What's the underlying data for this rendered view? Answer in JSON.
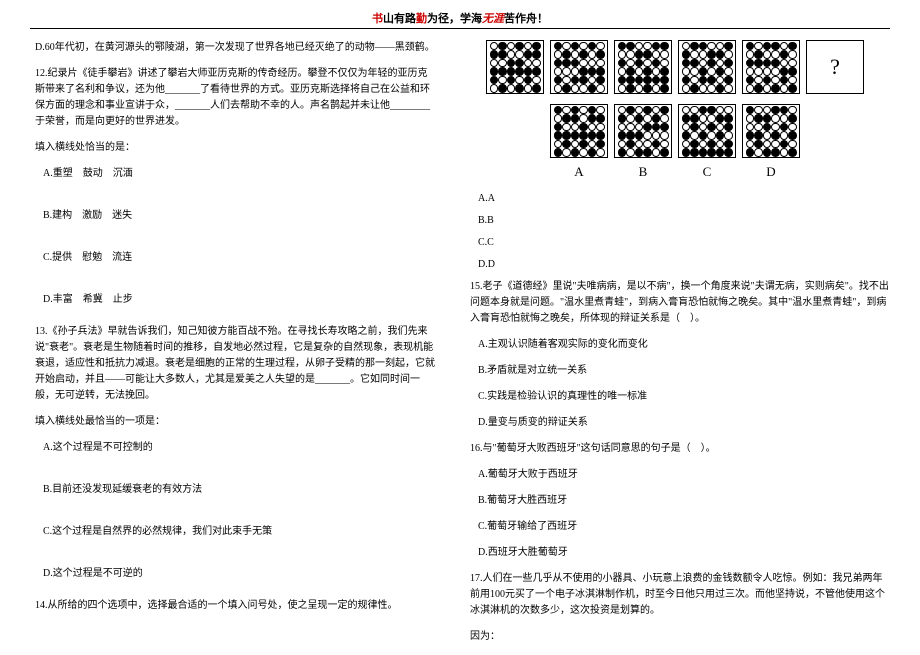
{
  "header": {
    "p1a": "书",
    "p1b": "山有路",
    "p1c": "勤",
    "p1d": "为径，学海",
    "p1e": "无涯",
    "p1f": "苦作舟！"
  },
  "left": {
    "q11d": "D.60年代初，在黄河源头的鄂陵湖，第一次发现了世界各地已经灭绝了的动物——黑颈鹤。",
    "q12": "12.纪录片《徒手攀岩》讲述了攀岩大师亚历克斯的传奇经历。攀登不仅仅为年轻的亚历克斯带来了名利和争议，还为他_______了看待世界的方式。亚历克斯选择将自己在公益和环保方面的理念和事业宣讲于众，_______人们去帮助不幸的人。声名鹊起并未让他________于荣誉，而是向更好的世界进发。",
    "q12prompt": "填入横线处恰当的是：",
    "q12a": "A.重塑　鼓动　沉湎",
    "q12b": "B.建构　激励　迷失",
    "q12c": "C.提供　慰勉　流连",
    "q12d": "D.丰富　希冀　止步",
    "q13": "13.《孙子兵法》早就告诉我们，知己知彼方能百战不殆。在寻找长寿攻略之前，我们先来说\"衰老\"。衰老是生物随着时间的推移，自发地必然过程，它是复杂的自然现象，表现机能衰退，适应性和抵抗力减退。衰老是细胞的正常的生理过程，从卵子受精的那一刻起，它就开始启动，并且——可能让大多数人，尤其是爱美之人失望的是_______。它如同时间一般，无可逆转，无法挽回。",
    "q13prompt": "填入横线处最恰当的一项是：",
    "q13a": "A.这个过程是不可控制的",
    "q13b": "B.目前还没发现延缓衰老的有效方法",
    "q13c": "C.这个过程是自然界的必然规律，我们对此束手无策",
    "q13d": "D.这个过程是不可逆的",
    "q14": "14.从所给的四个选项中，选择最合适的一个填入问号处，使之呈现一定的规律性。"
  },
  "right": {
    "puzzleLabels": {
      "a": "A",
      "b": "B",
      "c": "C",
      "d": "D"
    },
    "questionMark": "?",
    "q14a": "A.A",
    "q14b": "B.B",
    "q14c": "C.C",
    "q14d": "D.D",
    "q15": "15.老子《道德经》里说\"夫唯病病，是以不病\"，换一个角度来说\"夫谓无病，实则病矣\"。找不出问题本身就是问题。\"温水里煮青蛙\"，到病入膏肓恐怕就悔之晚矣。其中\"温水里煮青蛙\"，到病入膏肓恐怕就悔之晚矣，所体现的辩证关系是（　）。",
    "q15a": "A.主观认识随着客观实际的变化而变化",
    "q15b": "B.矛盾就是对立统一关系",
    "q15c": "C.实践是检验认识的真理性的唯一标准",
    "q15d": "D.量变与质变的辩证关系",
    "q16": "16.与\"葡萄牙大败西班牙\"这句话同意思的句子是（　）。",
    "q16a": "A.葡萄牙大败于西班牙",
    "q16b": "B.葡萄牙大胜西班牙",
    "q16c": "C.葡萄牙输给了西班牙",
    "q16d": "D.西班牙大胜葡萄牙",
    "q17": "17.人们在一些几乎从不使用的小器具、小玩意上浪费的金钱数额令人吃惊。例如：我兄弟两年前用100元买了一个电子冰淇淋制作机，时至今日他只用过三次。而他坚持说，不管他使用这个冰淇淋机的次数多少，这次投资是划算的。",
    "q17reason": "因为："
  },
  "puzzles": {
    "top": [
      [
        [
          0,
          1,
          0,
          1,
          0,
          1
        ],
        [
          1,
          1,
          0,
          0,
          1,
          1
        ],
        [
          0,
          0,
          1,
          1,
          0,
          0
        ],
        [
          1,
          1,
          1,
          1,
          1,
          1
        ],
        [
          1,
          0,
          1,
          0,
          1,
          0
        ],
        [
          0,
          1,
          0,
          1,
          0,
          1
        ]
      ],
      [
        [
          1,
          0,
          1,
          0,
          1,
          0
        ],
        [
          0,
          1,
          0,
          1,
          0,
          1
        ],
        [
          1,
          1,
          1,
          0,
          0,
          0
        ],
        [
          0,
          0,
          0,
          1,
          1,
          1
        ],
        [
          1,
          0,
          1,
          1,
          0,
          1
        ],
        [
          0,
          1,
          0,
          0,
          1,
          0
        ]
      ],
      [
        [
          1,
          1,
          0,
          0,
          1,
          1
        ],
        [
          0,
          0,
          1,
          1,
          0,
          0
        ],
        [
          1,
          0,
          1,
          0,
          1,
          0
        ],
        [
          0,
          1,
          0,
          1,
          0,
          1
        ],
        [
          1,
          1,
          1,
          1,
          1,
          1
        ],
        [
          0,
          1,
          0,
          1,
          0,
          1
        ]
      ],
      [
        [
          0,
          1,
          1,
          0,
          0,
          1
        ],
        [
          1,
          0,
          0,
          1,
          1,
          0
        ],
        [
          1,
          1,
          0,
          1,
          0,
          1
        ],
        [
          0,
          0,
          1,
          0,
          1,
          0
        ],
        [
          1,
          0,
          1,
          1,
          0,
          1
        ],
        [
          0,
          1,
          0,
          0,
          1,
          0
        ]
      ],
      [
        [
          1,
          0,
          1,
          1,
          0,
          1
        ],
        [
          0,
          1,
          0,
          0,
          1,
          0
        ],
        [
          1,
          1,
          1,
          1,
          0,
          0
        ],
        [
          0,
          0,
          0,
          0,
          1,
          1
        ],
        [
          1,
          0,
          1,
          0,
          1,
          0
        ],
        [
          0,
          1,
          0,
          1,
          0,
          1
        ]
      ]
    ],
    "bottom": [
      [
        [
          1,
          0,
          1,
          0,
          1,
          0
        ],
        [
          0,
          1,
          1,
          0,
          1,
          1
        ],
        [
          1,
          0,
          0,
          1,
          0,
          0
        ],
        [
          1,
          1,
          1,
          1,
          1,
          1
        ],
        [
          0,
          1,
          0,
          1,
          0,
          1
        ],
        [
          1,
          0,
          1,
          0,
          1,
          0
        ]
      ],
      [
        [
          0,
          1,
          0,
          1,
          0,
          1
        ],
        [
          1,
          0,
          1,
          0,
          1,
          0
        ],
        [
          0,
          0,
          0,
          1,
          1,
          1
        ],
        [
          1,
          1,
          1,
          0,
          0,
          0
        ],
        [
          0,
          1,
          0,
          0,
          1,
          0
        ],
        [
          1,
          0,
          1,
          1,
          0,
          1
        ]
      ],
      [
        [
          0,
          0,
          1,
          1,
          0,
          0
        ],
        [
          1,
          1,
          0,
          0,
          1,
          1
        ],
        [
          0,
          1,
          0,
          1,
          0,
          1
        ],
        [
          1,
          0,
          1,
          0,
          1,
          0
        ],
        [
          0,
          1,
          0,
          1,
          0,
          1
        ],
        [
          1,
          1,
          1,
          1,
          1,
          1
        ]
      ],
      [
        [
          1,
          0,
          0,
          1,
          1,
          0
        ],
        [
          0,
          1,
          1,
          0,
          0,
          1
        ],
        [
          0,
          0,
          1,
          0,
          1,
          0
        ],
        [
          1,
          1,
          0,
          1,
          0,
          1
        ],
        [
          0,
          1,
          0,
          0,
          1,
          0
        ],
        [
          1,
          0,
          1,
          1,
          0,
          1
        ]
      ]
    ]
  }
}
